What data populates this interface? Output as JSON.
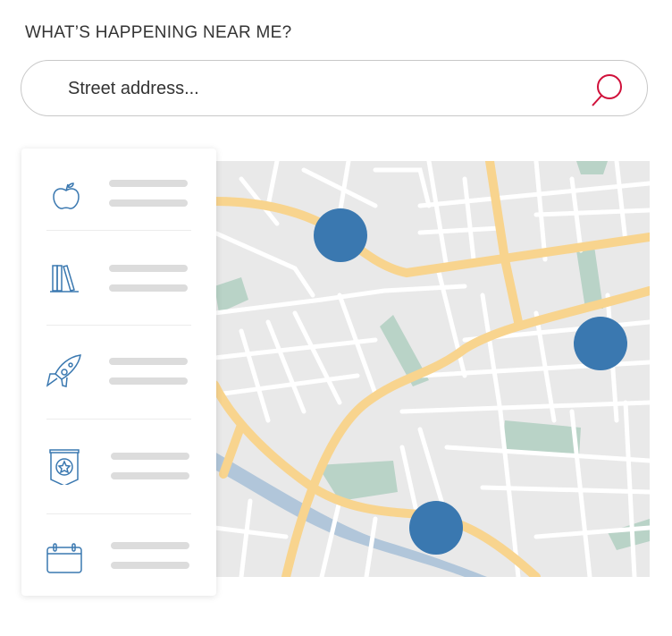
{
  "header": {
    "title": "WHAT’S HAPPENING NEAR ME?"
  },
  "search": {
    "placeholder": "Street address...",
    "value": "",
    "icon": "search-icon"
  },
  "colors": {
    "accent": "#d0103a",
    "icon_blue": "#3a78b0",
    "pin": "#3a78b0",
    "road": "#f8d48e",
    "park": "#b9d3c7",
    "river": "#b1c6da",
    "map_bg": "#e9e9e9"
  },
  "categories": [
    {
      "icon": "apple-icon"
    },
    {
      "icon": "books-icon"
    },
    {
      "icon": "rocket-icon"
    },
    {
      "icon": "banner-star-icon"
    },
    {
      "icon": "calendar-icon"
    }
  ],
  "map": {
    "pins": 3
  }
}
